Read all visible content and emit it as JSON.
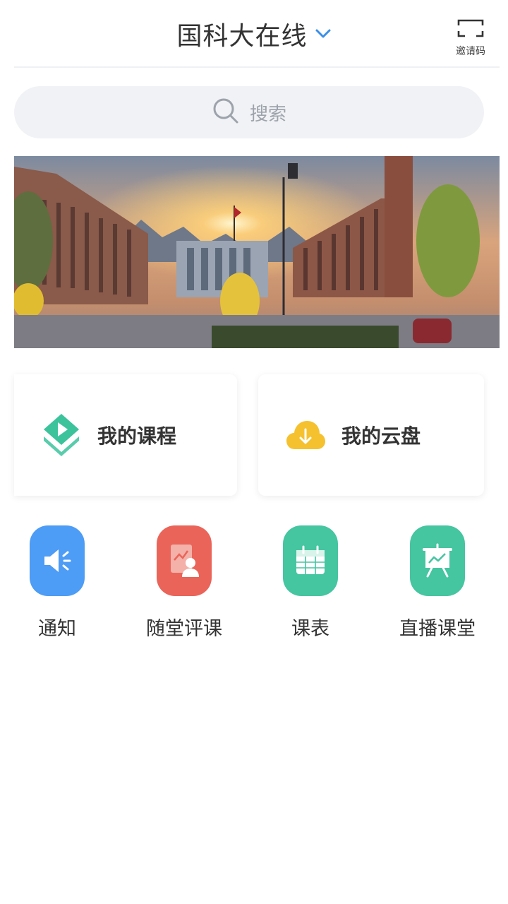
{
  "header": {
    "title": "国科大在线",
    "invite_label": "邀请码"
  },
  "search": {
    "placeholder": "搜索"
  },
  "cards": [
    {
      "label": "我的课程",
      "icon": "course-play-icon",
      "color": "#3cc39c"
    },
    {
      "label": "我的云盘",
      "icon": "cloud-download-icon",
      "color": "#f5c12e"
    }
  ],
  "quick_actions": [
    {
      "label": "通知",
      "icon": "speaker-icon",
      "color": "#4d9cf5"
    },
    {
      "label": "随堂评课",
      "icon": "evaluation-icon",
      "color": "#ea6459"
    },
    {
      "label": "课表",
      "icon": "calendar-icon",
      "color": "#45c5a0"
    },
    {
      "label": "直播课堂",
      "icon": "live-board-icon",
      "color": "#45c5a0"
    }
  ],
  "colors": {
    "accent": "#3a8fe8",
    "search_bg": "#f1f2f5"
  }
}
